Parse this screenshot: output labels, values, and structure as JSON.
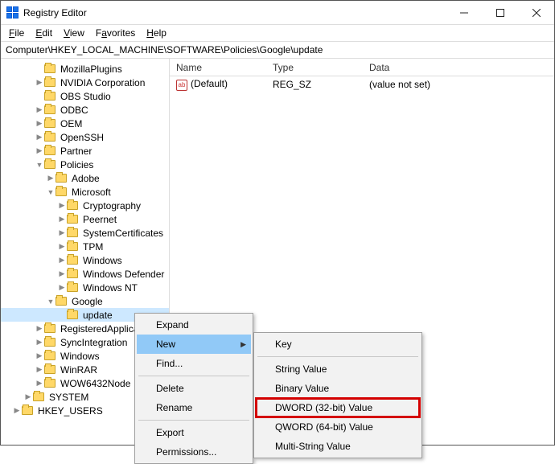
{
  "window": {
    "title": "Registry Editor"
  },
  "menubar": {
    "file": "File",
    "edit": "Edit",
    "view": "View",
    "favorites": "Favorites",
    "help": "Help"
  },
  "address": "Computer\\HKEY_LOCAL_MACHINE\\SOFTWARE\\Policies\\Google\\update",
  "tree": {
    "items": [
      {
        "indent": 3,
        "tw": "",
        "label": "MozillaPlugins"
      },
      {
        "indent": 3,
        "tw": ">",
        "label": "NVIDIA Corporation"
      },
      {
        "indent": 3,
        "tw": "",
        "label": "OBS Studio"
      },
      {
        "indent": 3,
        "tw": ">",
        "label": "ODBC"
      },
      {
        "indent": 3,
        "tw": ">",
        "label": "OEM"
      },
      {
        "indent": 3,
        "tw": ">",
        "label": "OpenSSH"
      },
      {
        "indent": 3,
        "tw": ">",
        "label": "Partner"
      },
      {
        "indent": 3,
        "tw": "v",
        "label": "Policies"
      },
      {
        "indent": 4,
        "tw": ">",
        "label": "Adobe"
      },
      {
        "indent": 4,
        "tw": "v",
        "label": "Microsoft"
      },
      {
        "indent": 5,
        "tw": ">",
        "label": "Cryptography"
      },
      {
        "indent": 5,
        "tw": ">",
        "label": "Peernet"
      },
      {
        "indent": 5,
        "tw": ">",
        "label": "SystemCertificates"
      },
      {
        "indent": 5,
        "tw": ">",
        "label": "TPM"
      },
      {
        "indent": 5,
        "tw": ">",
        "label": "Windows"
      },
      {
        "indent": 5,
        "tw": ">",
        "label": "Windows Defender"
      },
      {
        "indent": 5,
        "tw": ">",
        "label": "Windows NT"
      },
      {
        "indent": 4,
        "tw": "v",
        "label": "Google"
      },
      {
        "indent": 5,
        "tw": "",
        "label": "update",
        "selected": true
      },
      {
        "indent": 3,
        "tw": ">",
        "label": "RegisteredApplications"
      },
      {
        "indent": 3,
        "tw": ">",
        "label": "SyncIntegration"
      },
      {
        "indent": 3,
        "tw": ">",
        "label": "Windows"
      },
      {
        "indent": 3,
        "tw": ">",
        "label": "WinRAR"
      },
      {
        "indent": 3,
        "tw": ">",
        "label": "WOW6432Node"
      },
      {
        "indent": 2,
        "tw": ">",
        "label": "SYSTEM"
      },
      {
        "indent": 1,
        "tw": ">",
        "label": "HKEY_USERS"
      }
    ]
  },
  "list": {
    "columns": {
      "name": "Name",
      "type": "Type",
      "data": "Data"
    },
    "rows": [
      {
        "name": "(Default)",
        "type": "REG_SZ",
        "data": "(value not set)",
        "icon": "ab"
      }
    ]
  },
  "ctx1": {
    "expand": "Expand",
    "new": "New",
    "find": "Find...",
    "delete": "Delete",
    "rename": "Rename",
    "export": "Export",
    "permissions": "Permissions..."
  },
  "ctx2": {
    "key": "Key",
    "string": "String Value",
    "binary": "Binary Value",
    "dword": "DWORD (32-bit) Value",
    "qword": "QWORD (64-bit) Value",
    "multi": "Multi-String Value"
  }
}
